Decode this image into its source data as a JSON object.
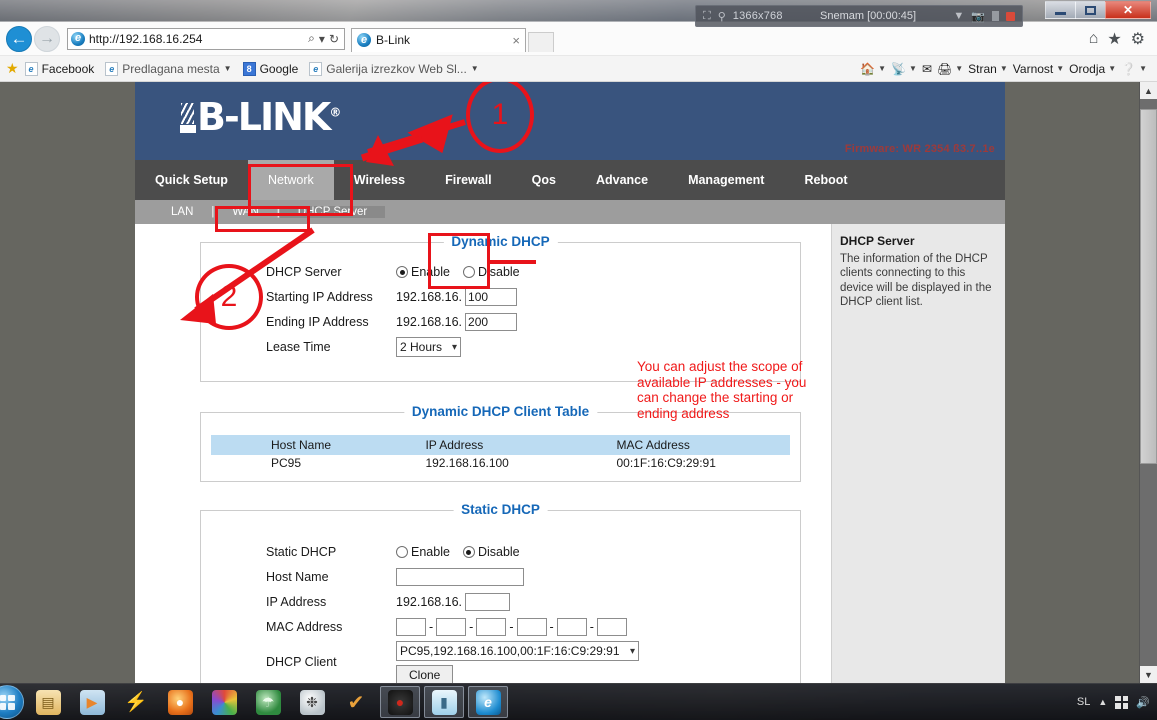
{
  "browser": {
    "back_icon": "back-arrow-icon",
    "forward_icon": "forward-arrow-icon",
    "url": "http://192.168.16.254",
    "search_icon": "search-icon",
    "refresh_icon": "refresh-icon",
    "tab_title": "B-Link",
    "tab_close": "×",
    "home_icon": "home-icon",
    "favorites_icon": "star-icon",
    "tools_icon": "gear-icon"
  },
  "window_controls": {
    "minimize": "minimize-button",
    "maximize": "maximize-button",
    "close": "✕"
  },
  "recorder": {
    "dimensions": "1366x768",
    "status": "Snemam [00:00:45]",
    "dropdown_icon": "chevron-down-icon",
    "camera_icon": "camera-icon",
    "pause_icon": "pause-icon",
    "stop_icon": "stop-record-icon"
  },
  "favorites": {
    "items": [
      {
        "label": "Facebook",
        "icon": "page-icon",
        "dim": false,
        "caret": false
      },
      {
        "label": "Predlagana mesta",
        "icon": "page-icon",
        "dim": true,
        "caret": true
      },
      {
        "label": "Google",
        "icon": "google-icon",
        "dim": false,
        "caret": false
      },
      {
        "label": "Galerija izrezkov Web Sl...",
        "icon": "page-icon",
        "dim": true,
        "caret": true
      }
    ],
    "tools": [
      "Stran",
      "Varnost",
      "Orodja"
    ],
    "home_icon": "home-icon",
    "feeds_icon": "rss-icon",
    "mail_icon": "mail-icon",
    "print_icon": "print-icon",
    "help_icon": "help-icon"
  },
  "router": {
    "brand": "B-LINK",
    "brand_reg": "®",
    "firmware": "Firmware: WR 2354 ß3.7..1e",
    "nav": [
      {
        "label": "Quick Setup",
        "active": false
      },
      {
        "label": "Network",
        "active": true
      },
      {
        "label": "Wireless",
        "active": false
      },
      {
        "label": "Firewall",
        "active": false
      },
      {
        "label": "Qos",
        "active": false
      },
      {
        "label": "Advance",
        "active": false
      },
      {
        "label": "Management",
        "active": false
      },
      {
        "label": "Reboot",
        "active": false
      }
    ],
    "subnav": [
      {
        "label": "LAN",
        "active": false
      },
      {
        "label": "WAN",
        "active": false
      },
      {
        "label": "DHCP Server",
        "active": true
      }
    ],
    "subnav_separator": "|",
    "dynamic_dhcp": {
      "legend": "Dynamic DHCP",
      "server_label": "DHCP Server",
      "enable_label": "Enable",
      "disable_label": "Disable",
      "server_value": "Enable",
      "starting_label": "Starting IP Address",
      "starting_prefix": "192.168.16.",
      "starting_value": "100",
      "ending_label": "Ending IP Address",
      "ending_prefix": "192.168.16.",
      "ending_value": "200",
      "lease_label": "Lease Time",
      "lease_value": "2 Hours"
    },
    "client_table": {
      "legend": "Dynamic DHCP Client Table",
      "columns": [
        "Host Name",
        "IP Address",
        "MAC Address"
      ],
      "rows": [
        {
          "host": "PC95",
          "ip": "192.168.16.100",
          "mac": "00:1F:16:C9:29:91"
        }
      ]
    },
    "static_dhcp": {
      "legend": "Static DHCP",
      "static_label": "Static DHCP",
      "enable_label": "Enable",
      "disable_label": "Disable",
      "static_value": "Disable",
      "host_label": "Host Name",
      "host_value": "",
      "ip_label": "IP Address",
      "ip_prefix": "192.168.16.",
      "ip_value": "",
      "mac_label": "MAC Address",
      "mac_octets": [
        "",
        "",
        "",
        "",
        "",
        ""
      ],
      "mac_separator": "-",
      "client_label": "DHCP Client",
      "client_value": "PC95,192.168.16.100,00:1F:16:C9:29:91",
      "clone_label": "Clone"
    },
    "help": {
      "title": "DHCP Server",
      "body": "The information of the DHCP clients connecting to this device will be displayed in the DHCP client list."
    }
  },
  "annotations": {
    "accent": "#e8131a",
    "step_one": "1",
    "step_two": "2",
    "note": "You can adjust the scope of available IP addresses - you can change the starting or ending address"
  },
  "scrollbar": {
    "up_icon": "chevron-up-icon",
    "down_icon": "chevron-down-icon"
  },
  "taskbar": {
    "start_icon": "windows-start-icon",
    "items": [
      {
        "name": "file-explorer-icon",
        "glyph": "▤",
        "color": "#efc061",
        "boxed": false
      },
      {
        "name": "media-player-icon",
        "glyph": "▶",
        "color": "#e8852c",
        "boxed": false
      },
      {
        "name": "winamp-icon",
        "glyph": "⚡",
        "color": "#f0c93a",
        "boxed": false
      },
      {
        "name": "firefox-icon",
        "glyph": "◉",
        "color": "#e8701a",
        "boxed": false
      },
      {
        "name": "color-wheel-icon",
        "glyph": "●",
        "color": "#7ab4e0",
        "boxed": false
      },
      {
        "name": "leaf-browser-icon",
        "glyph": "◐",
        "color": "#3f9a4a",
        "boxed": false
      },
      {
        "name": "network-tool-icon",
        "glyph": "✵",
        "color": "#cfd4d8",
        "boxed": false
      },
      {
        "name": "checkmark-icon",
        "glyph": "✔",
        "color": "#e8a03a",
        "boxed": false
      },
      {
        "name": "record-app-icon",
        "glyph": "●",
        "color": "#d0281c",
        "boxed": true
      },
      {
        "name": "notepad-icon",
        "glyph": "▱",
        "color": "#9ed0ea",
        "boxed": true
      },
      {
        "name": "internet-explorer-icon",
        "glyph": "e",
        "color": "#1e8cd0",
        "boxed": true
      }
    ],
    "tray": {
      "language": "SL",
      "show_hidden_icon": "chevron-up-icon",
      "network_icon": "windows-icon",
      "volume_icon": "speaker-icon"
    }
  }
}
